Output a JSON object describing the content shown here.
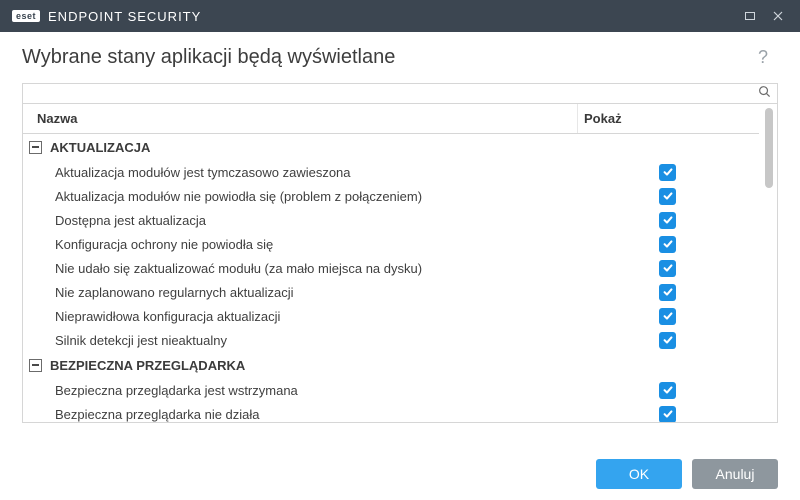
{
  "titlebar": {
    "brand_badge": "eset",
    "brand_text": "ENDPOINT SECURITY"
  },
  "dialog": {
    "title": "Wybrane stany aplikacji będą wyświetlane",
    "help": "?"
  },
  "table": {
    "headers": {
      "name": "Nazwa",
      "show": "Pokaż"
    },
    "groups": [
      {
        "title": "AKTUALIZACJA",
        "items": [
          {
            "name": "Aktualizacja modułów jest tymczasowo zawieszona",
            "checked": true
          },
          {
            "name": "Aktualizacja modułów nie powiodła się (problem z połączeniem)",
            "checked": true
          },
          {
            "name": "Dostępna jest aktualizacja",
            "checked": true
          },
          {
            "name": "Konfiguracja ochrony nie powiodła się",
            "checked": true
          },
          {
            "name": "Nie udało się zaktualizować modułu (za mało miejsca na dysku)",
            "checked": true
          },
          {
            "name": "Nie zaplanowano regularnych aktualizacji",
            "checked": true
          },
          {
            "name": "Nieprawidłowa konfiguracja aktualizacji",
            "checked": true
          },
          {
            "name": "Silnik detekcji jest nieaktualny",
            "checked": true
          }
        ]
      },
      {
        "title": "BEZPIECZNA PRZEGLĄDARKA",
        "items": [
          {
            "name": "Bezpieczna przeglądarka jest wstrzymana",
            "checked": true
          },
          {
            "name": "Bezpieczna przeglądarka nie działa",
            "checked": true
          }
        ]
      }
    ]
  },
  "footer": {
    "ok": "OK",
    "cancel": "Anuluj"
  }
}
